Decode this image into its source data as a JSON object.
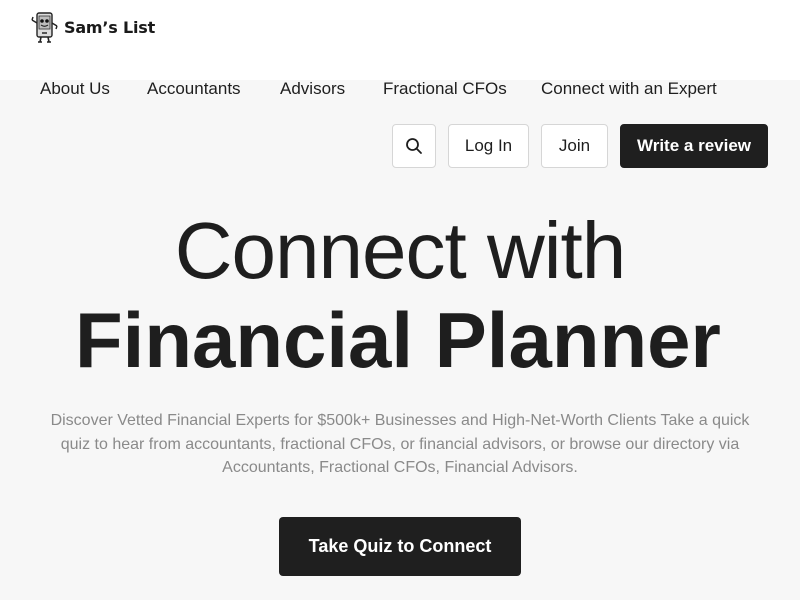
{
  "brand": {
    "name": "Sam’s List",
    "logo_icon": "phone-robot-mascot-icon"
  },
  "nav": {
    "items": [
      {
        "label": "About Us"
      },
      {
        "label": "Accountants"
      },
      {
        "label": "Advisors"
      },
      {
        "label": "Fractional CFOs"
      },
      {
        "label": "Connect with an Expert"
      }
    ]
  },
  "actions": {
    "search_icon": "search-icon",
    "login_label": "Log In",
    "join_label": "Join",
    "review_label": "Write a review"
  },
  "hero": {
    "line1": "Connect with",
    "line2": "Financial Planner",
    "description": "Discover Vetted Financial Experts for $500k+ Businesses and High-Net-Worth Clients Take a quick quiz to hear from accountants, fractional CFOs, or financial advisors, or browse our directory via Accountants, Fractional CFOs, Financial Advisors.",
    "cta_label": "Take Quiz to Connect"
  },
  "colors": {
    "background": "#f7f7f7",
    "header": "#ffffff",
    "dark_button": "#1f1f1f",
    "text": "#1e1e1e",
    "muted_text": "#8a8a8a",
    "border": "#d6d6d6"
  }
}
